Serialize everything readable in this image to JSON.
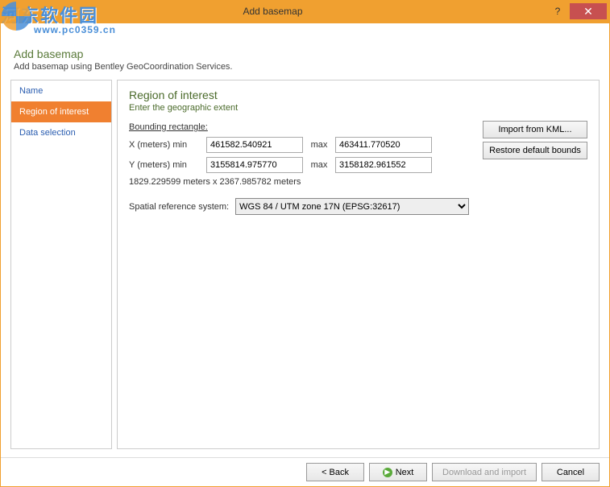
{
  "titlebar": {
    "title": "Add basemap",
    "help": "?",
    "close": "✕"
  },
  "watermark": {
    "brand": "河东软件园",
    "url": "www.pc0359.cn"
  },
  "header": {
    "title": "Add basemap",
    "subtitle": "Add basemap using Bentley GeoCoordination Services."
  },
  "sidebar": {
    "items": [
      {
        "label": "Name",
        "active": false
      },
      {
        "label": "Region of interest",
        "active": true
      },
      {
        "label": "Data selection",
        "active": false
      }
    ]
  },
  "main": {
    "title": "Region of interest",
    "subtitle": "Enter the geographic extent",
    "bounding_label": "Bounding rectangle:",
    "x_label": "X (meters)  min",
    "y_label": "Y (meters)  min",
    "max_label": "max",
    "x_min": "461582.540921",
    "x_max": "463411.770520",
    "y_min": "3155814.975770",
    "y_max": "3158182.961552",
    "dims": "1829.229599 meters x 2367.985782 meters",
    "srs_label": "Spatial reference system:",
    "srs_value": "WGS 84 / UTM zone 17N (EPSG:32617)",
    "import_kml": "Import from KML...",
    "restore_bounds": "Restore default bounds"
  },
  "footer": {
    "back": "< Back",
    "next": "Next",
    "download": "Download and import",
    "cancel": "Cancel"
  }
}
